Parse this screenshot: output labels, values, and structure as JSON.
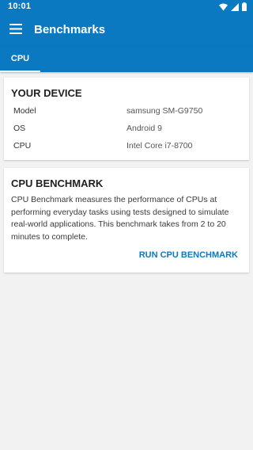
{
  "status_bar": {
    "time": "10:01",
    "icons": [
      "wifi-icon",
      "signal-icon",
      "battery-icon"
    ]
  },
  "app_bar": {
    "title": "Benchmarks",
    "menu_icon": "hamburger-menu-icon"
  },
  "tabs": [
    {
      "label": "CPU",
      "selected": true
    }
  ],
  "device_card": {
    "title": "YOUR DEVICE",
    "specs": [
      {
        "label": "Model",
        "value": "samsung SM-G9750"
      },
      {
        "label": "OS",
        "value": "Android 9"
      },
      {
        "label": "CPU",
        "value": "Intel Core i7-8700"
      }
    ]
  },
  "benchmark_card": {
    "title": "CPU BENCHMARK",
    "description": "CPU Benchmark measures the performance of CPUs at performing everyday tasks using tests designed to simulate real-world applications. This benchmark takes from 2 to 20 minutes to complete.",
    "button_label": "RUN CPU BENCHMARK"
  },
  "colors": {
    "primary": "#0b79c1",
    "background": "#f2f2f2",
    "card": "#ffffff"
  }
}
